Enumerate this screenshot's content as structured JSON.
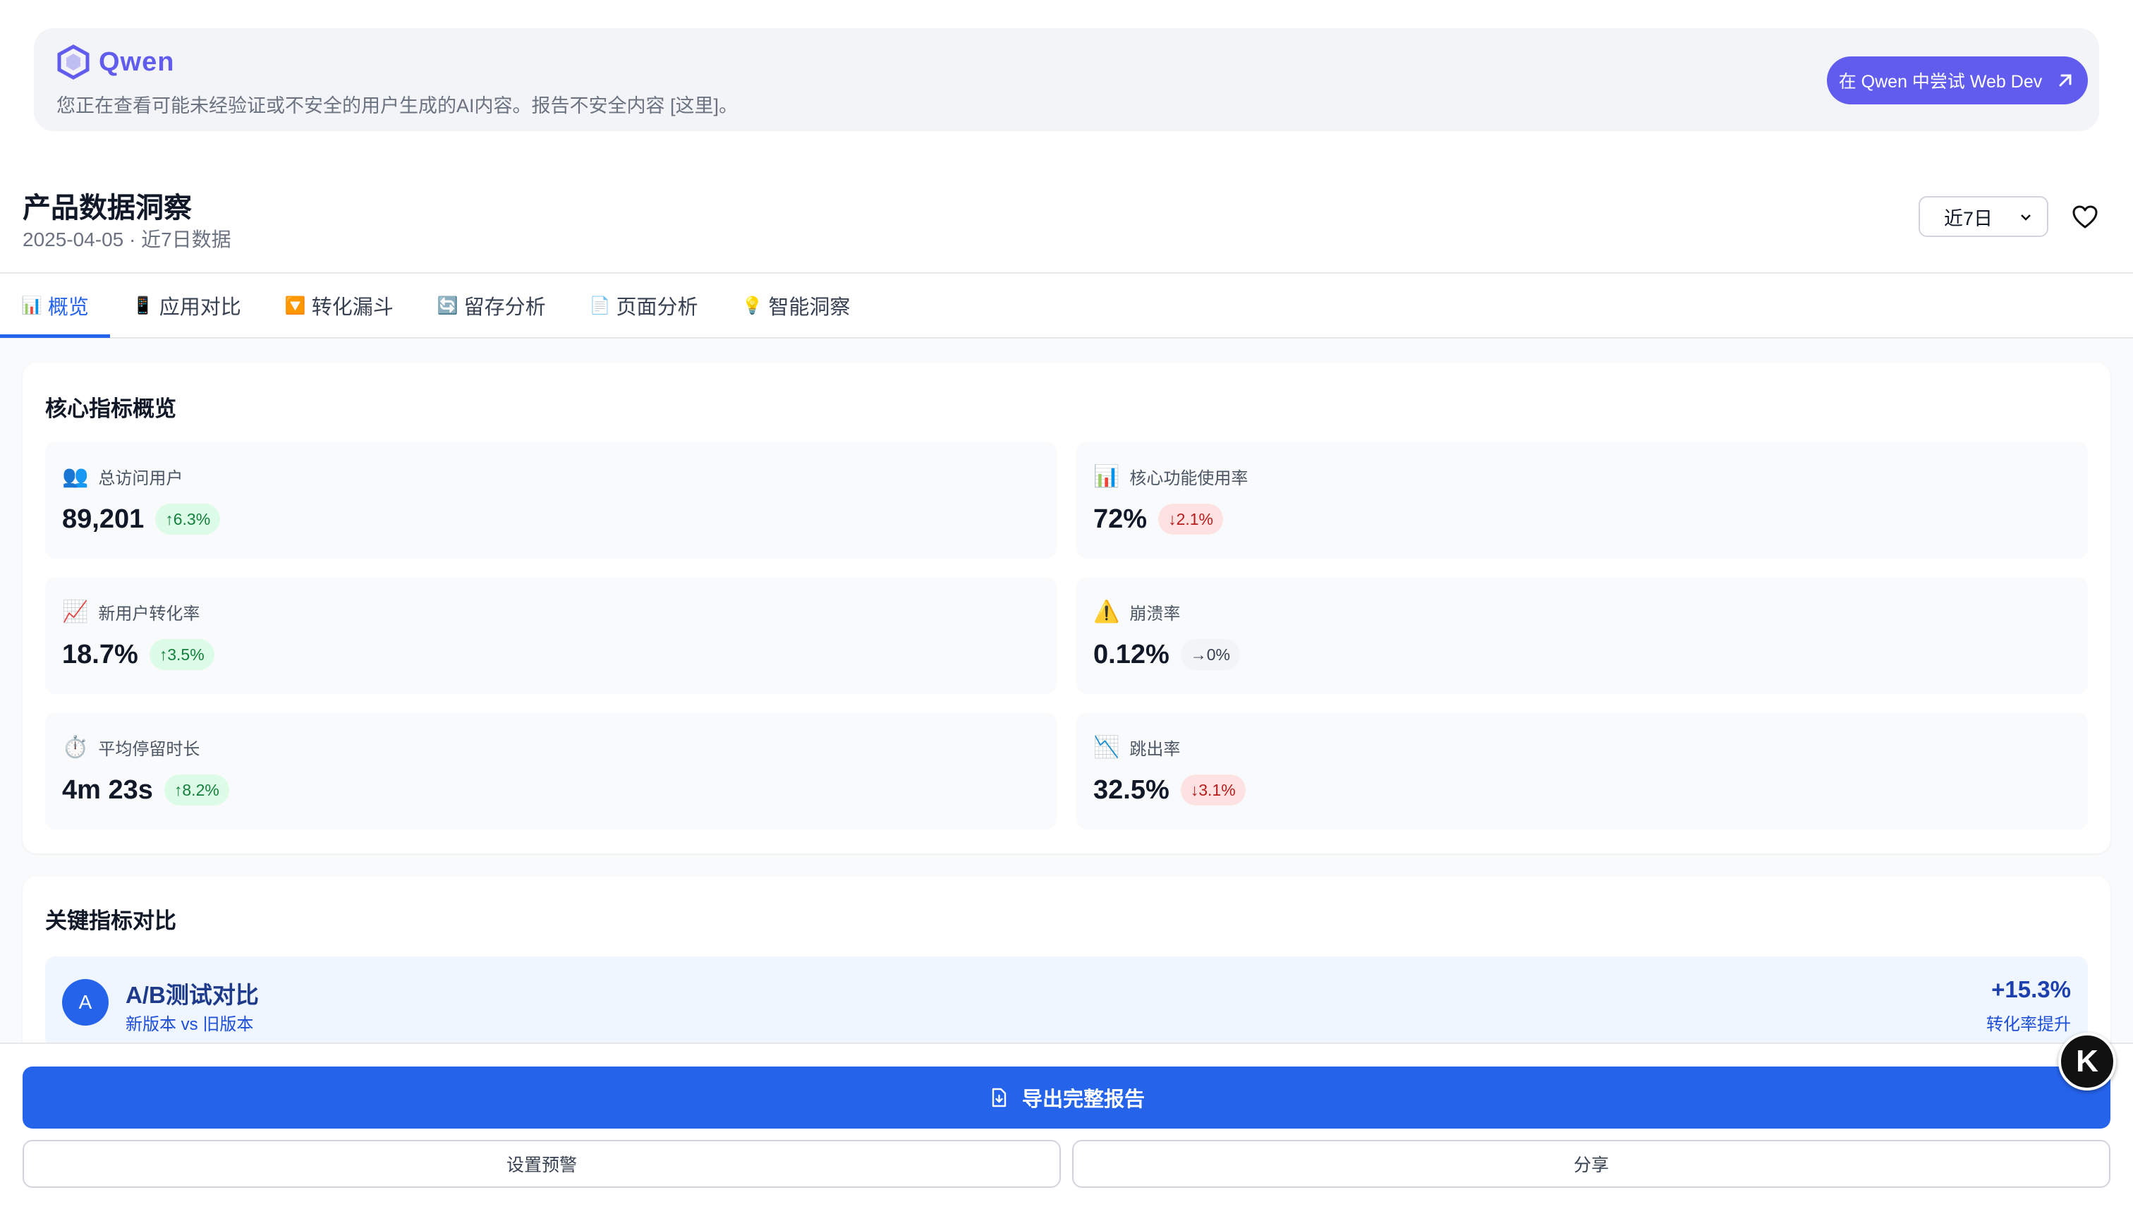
{
  "banner": {
    "brand": "Qwen",
    "note": "您正在查看可能未经验证或不安全的用户生成的AI内容。报告不安全内容 [这里]。",
    "try_button": "在 Qwen 中尝试 Web Dev"
  },
  "header": {
    "title": "产品数据洞察",
    "subtitle": "2025-04-05 · 近7日数据",
    "range_selected": "近7日"
  },
  "tabs": [
    {
      "icon": "📊",
      "label": "概览",
      "active": true
    },
    {
      "icon": "📱",
      "label": "应用对比"
    },
    {
      "icon": "🔽",
      "label": "转化漏斗"
    },
    {
      "icon": "🔄",
      "label": "留存分析"
    },
    {
      "icon": "📄",
      "label": "页面分析"
    },
    {
      "icon": "💡",
      "label": "智能洞察"
    }
  ],
  "core": {
    "title": "核心指标概览",
    "kpis": [
      {
        "icon": "👥",
        "label": "总访问用户",
        "value": "89,201",
        "change": "↑6.3%",
        "trend": "up"
      },
      {
        "icon": "📊",
        "label": "核心功能使用率",
        "value": "72%",
        "change": "↓2.1%",
        "trend": "down"
      },
      {
        "icon": "📈",
        "label": "新用户转化率",
        "value": "18.7%",
        "change": "↑3.5%",
        "trend": "up"
      },
      {
        "icon": "⚠️",
        "label": "崩溃率",
        "value": "0.12%",
        "change": "→0%",
        "trend": "flat"
      },
      {
        "icon": "⏱️",
        "label": "平均停留时长",
        "value": "4m 23s",
        "change": "↑8.2%",
        "trend": "up"
      },
      {
        "icon": "📉",
        "label": "跳出率",
        "value": "32.5%",
        "change": "↓3.1%",
        "trend": "down"
      }
    ]
  },
  "compare": {
    "title": "关键指标对比",
    "ab": {
      "letter": "A",
      "title": "A/B测试对比",
      "subtitle": "新版本 vs 旧版本",
      "value": "+15.3%",
      "note": "转化率提升"
    }
  },
  "footer": {
    "export": "导出完整报告",
    "alert": "设置预警",
    "share": "分享"
  },
  "fab_letter": "K",
  "colors": {
    "brand": "#615ced",
    "primary": "#2563eb",
    "up": "#15803d",
    "down": "#b91c1c"
  }
}
